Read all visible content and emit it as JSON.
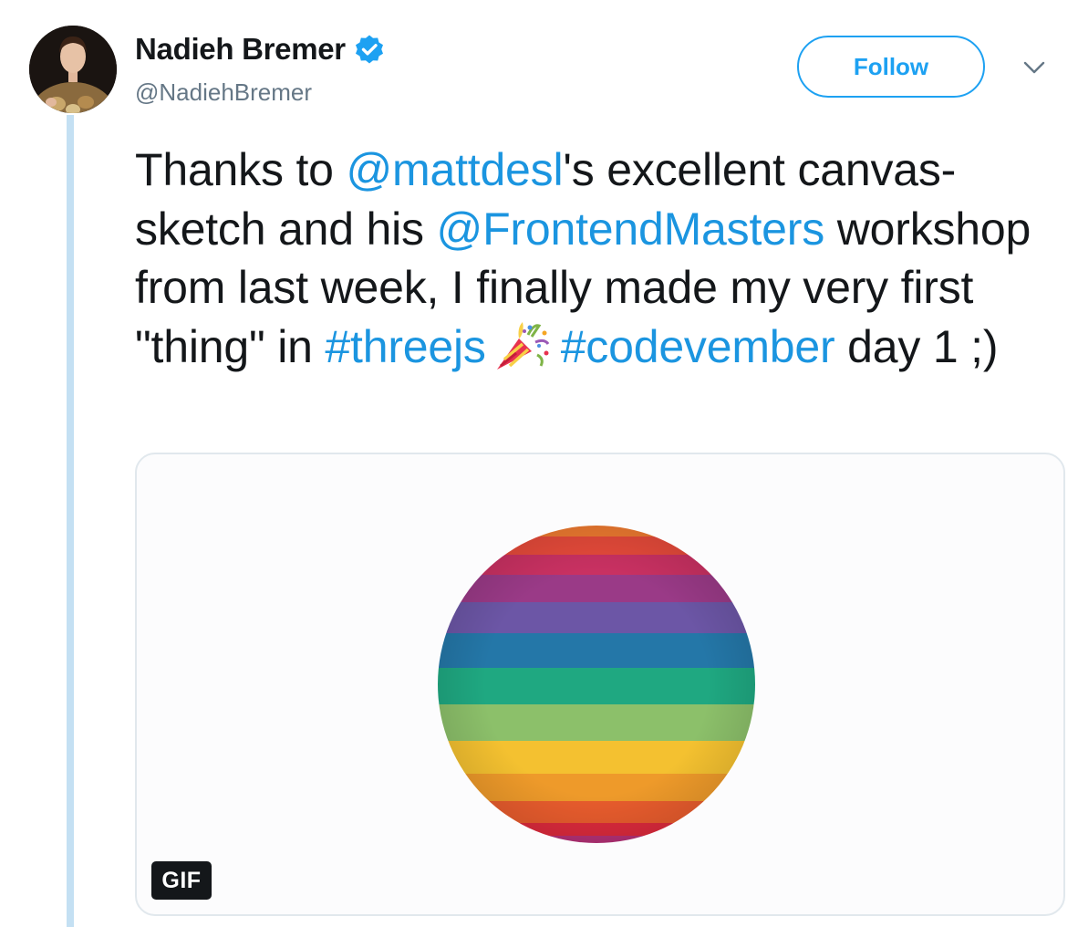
{
  "author": {
    "display_name": "Nadieh Bremer",
    "handle": "@NadiehBremer",
    "verified": true
  },
  "header": {
    "follow_label": "Follow"
  },
  "tweet": {
    "segments": [
      "Thanks to ",
      "@mattdesl",
      "'s excellent canvas-sketch and his ",
      "@FrontendMasters",
      " workshop from last week, I finally made my very first \"thing\" in ",
      "#threejs",
      "#codevember",
      " day 1 ;)"
    ],
    "emoji": "party-popper-icon"
  },
  "media": {
    "badge": "GIF"
  },
  "colors": {
    "accent": "#1da1f2",
    "link": "#1b95e0",
    "thread_line": "#c4e0f3",
    "text": "#14171a",
    "muted": "#657786"
  }
}
